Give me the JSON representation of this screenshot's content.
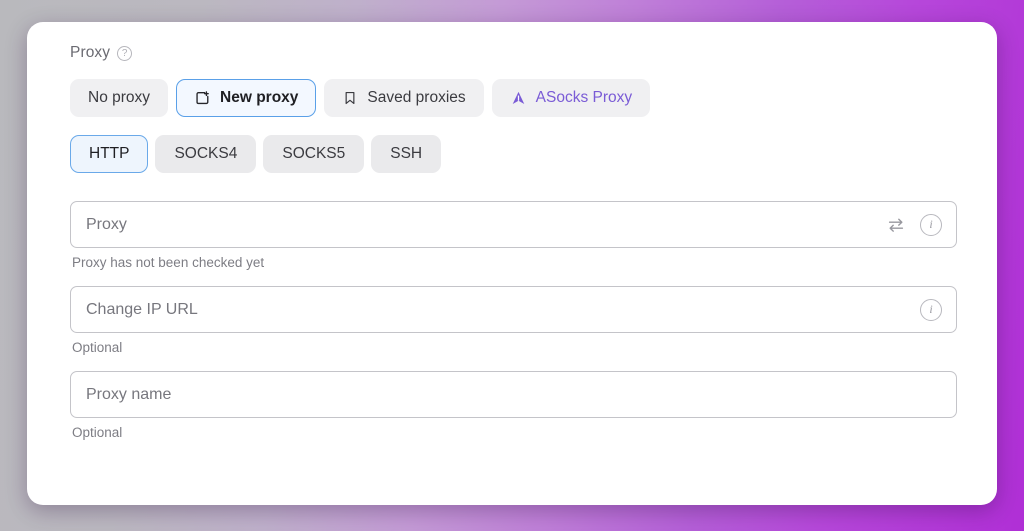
{
  "section": {
    "title": "Proxy",
    "help_icon": "question-circle-icon"
  },
  "source_tabs": [
    {
      "label": "No proxy",
      "icon": null,
      "active": false
    },
    {
      "label": "New proxy",
      "icon": "square-plus-icon",
      "active": true
    },
    {
      "label": "Saved proxies",
      "icon": "bookmark-icon",
      "active": false
    },
    {
      "label": "ASocks Proxy",
      "icon": "asocks-logo-icon",
      "active": false
    }
  ],
  "protocol_tabs": [
    {
      "label": "HTTP",
      "active": true
    },
    {
      "label": "SOCKS4",
      "active": false
    },
    {
      "label": "SOCKS5",
      "active": false
    },
    {
      "label": "SSH",
      "active": false
    }
  ],
  "fields": {
    "proxy": {
      "placeholder": "Proxy",
      "value": "",
      "helper": "Proxy has not been checked yet",
      "swap_icon": "swap-arrows-icon",
      "info_icon": "info-circle-icon"
    },
    "change_ip_url": {
      "placeholder": "Change IP URL",
      "value": "",
      "helper": "Optional",
      "info_icon": "info-circle-icon"
    },
    "proxy_name": {
      "placeholder": "Proxy name",
      "value": "",
      "helper": "Optional"
    }
  },
  "colors": {
    "accent_blue": "#5aa0e8",
    "accent_purple": "#7a5bd6",
    "tab_bg": "#f0f0f2",
    "background_gradient_start": "#b9b9bd",
    "background_gradient_end": "#b02fd6",
    "text_primary": "#3b3b40",
    "text_muted": "#7d7d84"
  }
}
